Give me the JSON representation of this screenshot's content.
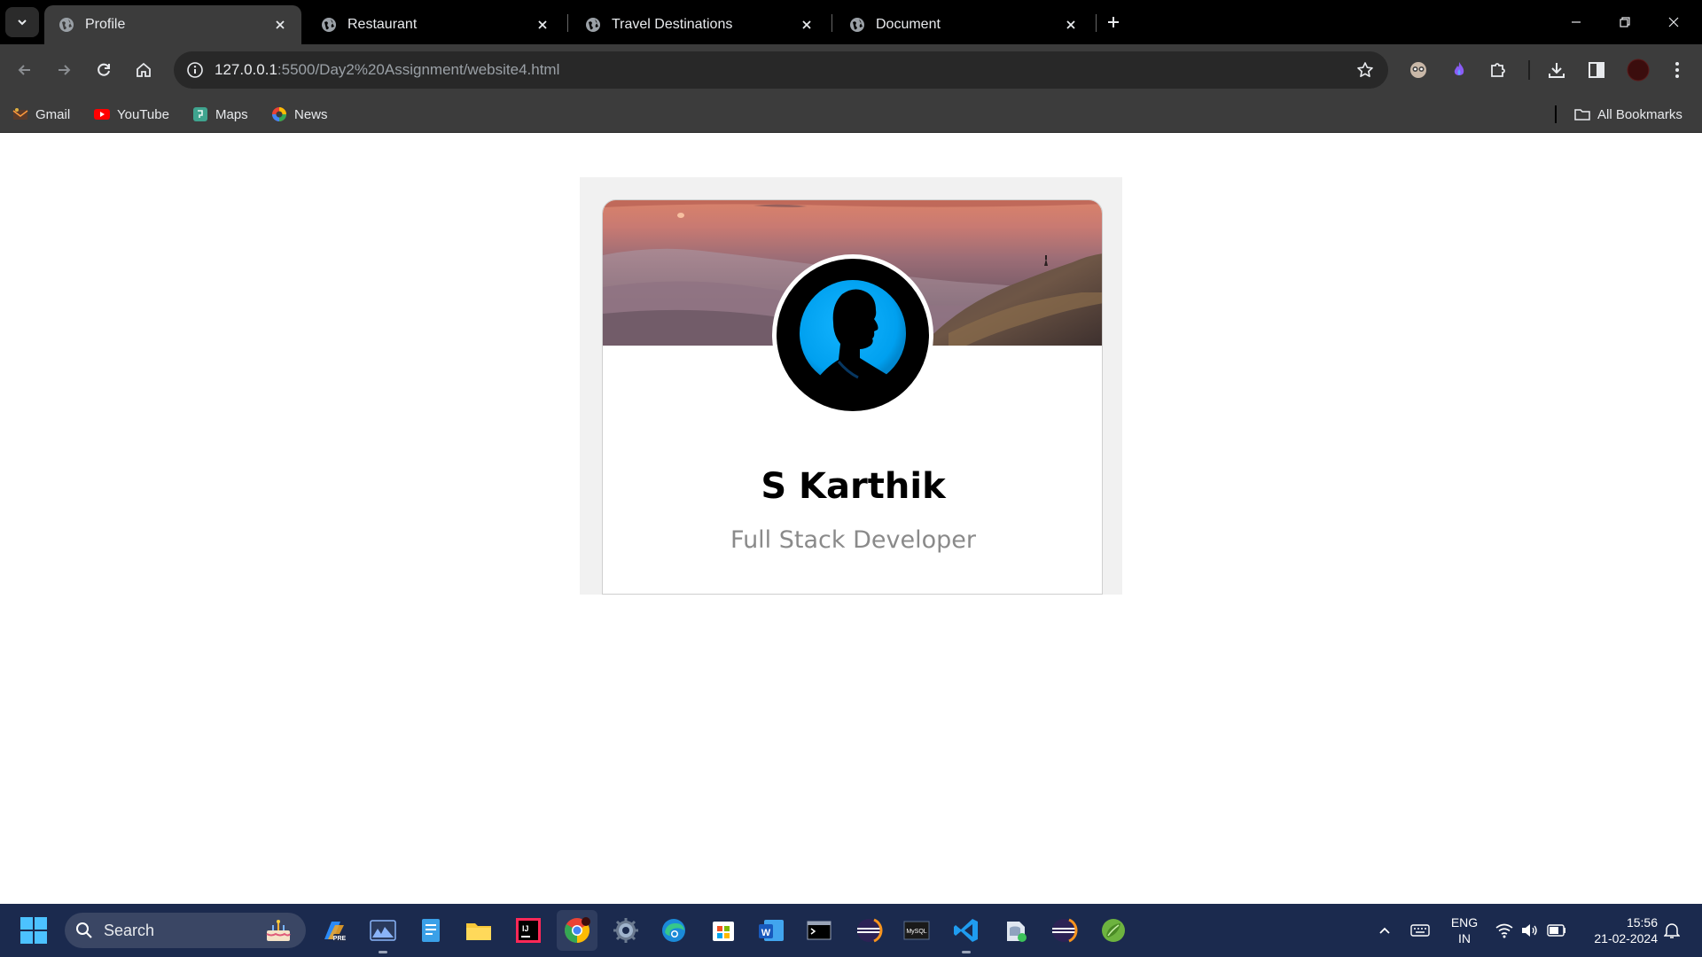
{
  "browser": {
    "tabs": [
      {
        "title": "Profile",
        "active": true
      },
      {
        "title": "Restaurant",
        "active": false
      },
      {
        "title": "Travel Destinations",
        "active": false
      },
      {
        "title": "Document",
        "active": false
      }
    ],
    "address": {
      "host": "127.0.0.1",
      "path": ":5500/Day2%20Assignment/website4.html"
    },
    "bookmarks": [
      {
        "label": "Gmail"
      },
      {
        "label": "YouTube"
      },
      {
        "label": "Maps"
      },
      {
        "label": "News"
      }
    ],
    "all_bookmarks_label": "All Bookmarks",
    "theme": {
      "frame": "#000000",
      "toolbar": "#3c3c3c",
      "omnibox": "#282828"
    }
  },
  "profile": {
    "name": "S Karthik",
    "role": "Full Stack Developer",
    "cover": "sunset-mountain-image",
    "avatar": "person-silhouette-avatar",
    "colors": {
      "avatar_ring": "#00a8ff",
      "role_text": "#8a8a8a"
    }
  },
  "taskbar": {
    "search_label": "Search",
    "apps": [
      "copilot-icon",
      "photos-icon",
      "notepad-icon",
      "file-explorer-icon",
      "intellij-icon",
      "chrome-icon",
      "settings-icon",
      "edge-icon",
      "microsoft-store-icon",
      "word-icon",
      "terminal-icon",
      "eclipse-icon",
      "mysql-workbench-icon",
      "vscode-icon",
      "db-tool-icon",
      "eclipse-2-icon",
      "spring-tools-icon"
    ],
    "tray": {
      "lang_line1": "ENG",
      "lang_line2": "IN",
      "time": "15:56",
      "date": "21-02-2024"
    }
  }
}
